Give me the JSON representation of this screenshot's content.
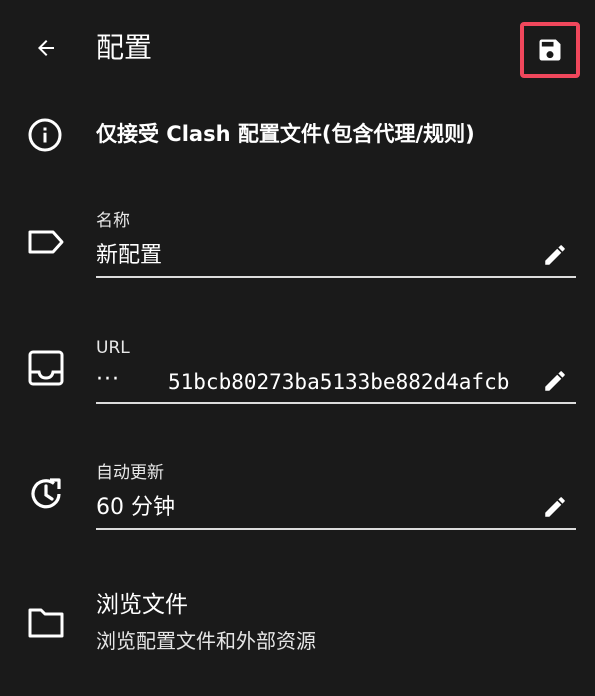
{
  "app_bar": {
    "title": "配置",
    "back_icon": "arrow-back-icon",
    "save_icon": "save-icon",
    "save_highlight_color": "#f0475c"
  },
  "info": {
    "icon": "info-icon",
    "text": "仅接受 Clash 配置文件(包含代理/规则)"
  },
  "fields": {
    "name": {
      "icon": "label-icon",
      "label": "名称",
      "value": "新配置"
    },
    "url": {
      "icon": "inbox-icon",
      "label": "URL",
      "value_prefix": "···",
      "value": "51bcb80273ba5133be882d4afcb"
    },
    "auto_update": {
      "icon": "update-icon",
      "label": "自动更新",
      "value": "60 分钟"
    }
  },
  "browse": {
    "icon": "folder-icon",
    "title": "浏览文件",
    "subtitle": "浏览配置文件和外部资源"
  },
  "colors": {
    "background": "#1a1a1a",
    "text": "#ffffff",
    "underline": "#dcdcdc"
  }
}
